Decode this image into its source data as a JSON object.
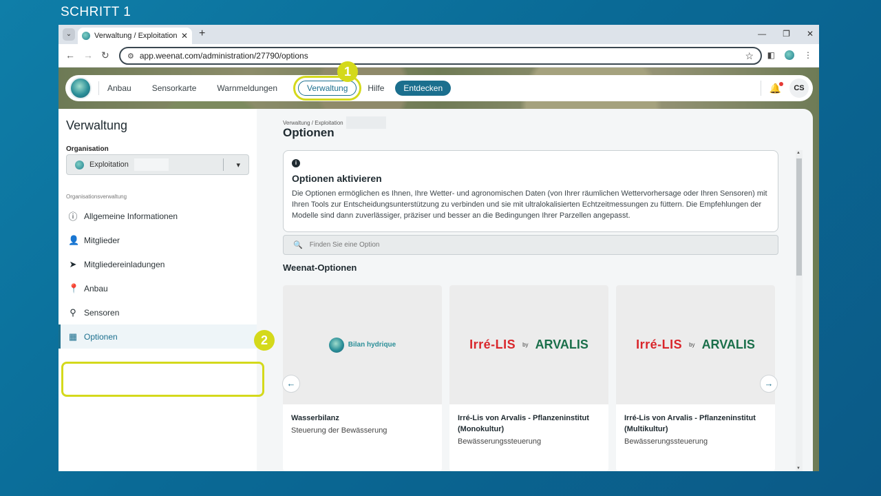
{
  "step_label": "SCHRITT 1",
  "browser": {
    "tab_title": "Verwaltung / Exploitation Sarge",
    "url": "app.weenat.com/administration/27790/options"
  },
  "nav": {
    "items": [
      "Anbau",
      "Sensorkarte",
      "Warnmeldungen"
    ],
    "active": "Verwaltung",
    "help": "Hilfe",
    "discover": "Entdecken",
    "avatar": "CS",
    "highlight_color": "#d4d91b"
  },
  "badges": {
    "one": "1",
    "two": "2"
  },
  "sidebar": {
    "title": "Verwaltung",
    "org_label": "Organisation",
    "org_name": "Exploitation",
    "section_label": "Organisationsverwaltung",
    "items": [
      {
        "label": "Allgemeine Informationen",
        "icon": "info-icon"
      },
      {
        "label": "Mitglieder",
        "icon": "person-icon"
      },
      {
        "label": "Mitgliedereinladungen",
        "icon": "send-icon"
      },
      {
        "label": "Anbau",
        "icon": "map-pin-person-icon"
      },
      {
        "label": "Sensoren",
        "icon": "sensor-icon"
      },
      {
        "label": "Optionen",
        "icon": "dashboard-add-icon"
      }
    ]
  },
  "main": {
    "breadcrumb": "Verwaltung / Exploitation",
    "title": "Optionen",
    "info_title": "Optionen aktivieren",
    "info_text": "Die Optionen ermöglichen es Ihnen, Ihre Wetter- und agronomischen Daten (von Ihrer räumlichen Wettervorhersage oder Ihren Sensoren) mit Ihren Tools zur Entscheidungsunterstützung zu verbinden und sie mit ultralokalisierten Echtzeitmessungen zu füttern. Die Empfehlungen der Modelle sind dann zuverlässiger, präziser und besser an die Bedingungen Ihrer Parzellen angepasst.",
    "search_placeholder": "Finden Sie eine Option",
    "section_title": "Weenat-Optionen",
    "cards": [
      {
        "title": "Wasserbilanz",
        "subtitle": "Steuerung der Bewässerung",
        "logo_text": "Bilan hydrique"
      },
      {
        "title": "Irré-Lis von Arvalis - Pflanzeninstitut (Monokultur)",
        "subtitle": "Bewässerungssteuerung",
        "logo_a": "Irré-LIS",
        "logo_by": "by",
        "logo_b": "ARVALIS"
      },
      {
        "title": "Irré-Lis von Arvalis - Pflanzeninstitut (Multikultur)",
        "subtitle": "Bewässerungssteuerung",
        "logo_a": "Irré-LIS",
        "logo_by": "by",
        "logo_b": "ARVALIS"
      }
    ]
  }
}
